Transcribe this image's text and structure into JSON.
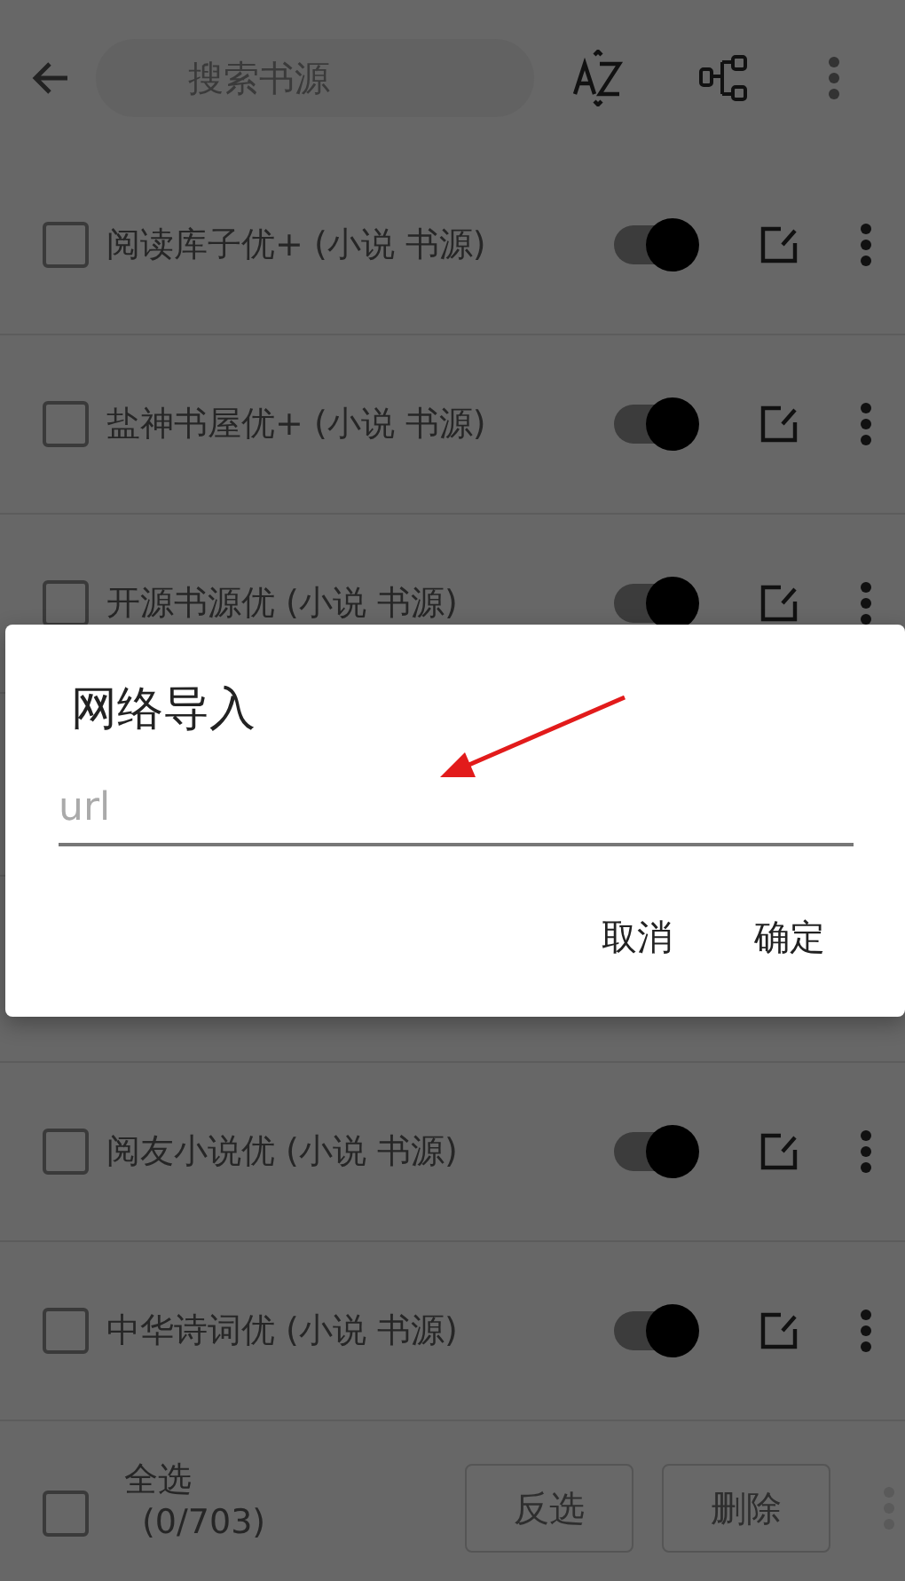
{
  "toolbar": {
    "search": {
      "placeholder": "搜索书源"
    }
  },
  "sources": [
    {
      "name": "阅读库子优+ (小说 书源)",
      "checked": false,
      "enabled": true
    },
    {
      "name": "盐神书屋优+ (小说 书源)",
      "checked": false,
      "enabled": true
    },
    {
      "name": "开源书源优 (小说 书源)",
      "checked": false,
      "enabled": true
    },
    {
      "kind": "hidden"
    },
    {
      "kind": "hidden"
    },
    {
      "name": "阅友小说优 (小说 书源)",
      "checked": false,
      "enabled": true
    },
    {
      "name": "中华诗词优 (小说 书源)",
      "checked": false,
      "enabled": true
    }
  ],
  "bottom_bar": {
    "select_all": {
      "label": "全选",
      "count": "(0/703)",
      "checked": false
    },
    "buttons": [
      "反选",
      "删除"
    ]
  },
  "dialog": {
    "title": "网络导入",
    "field": {
      "placeholder": "url"
    },
    "buttons": [
      "取消",
      "确定"
    ]
  }
}
